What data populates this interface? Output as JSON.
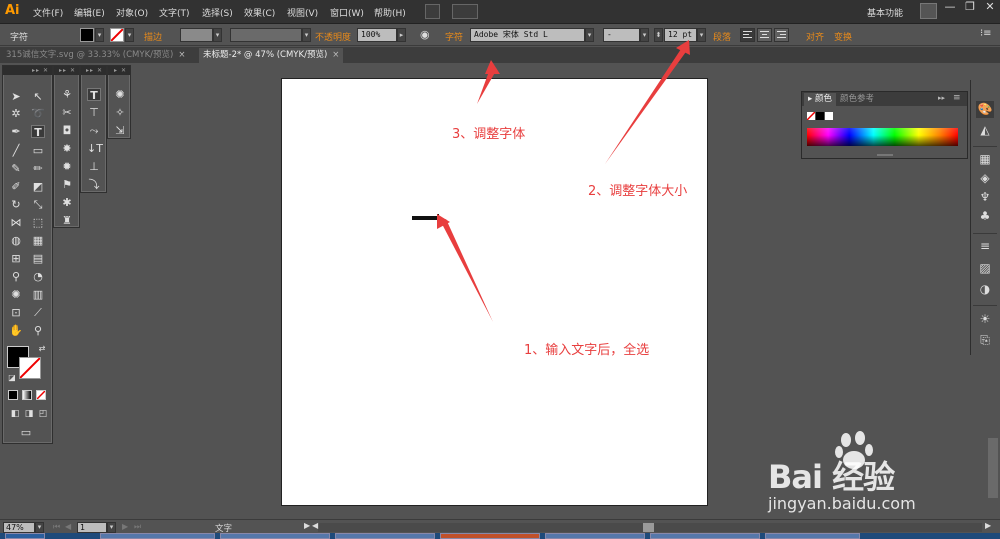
{
  "app": {
    "logo": "Ai",
    "menu": [
      "文件(F)",
      "编辑(E)",
      "对象(O)",
      "文字(T)",
      "选择(S)",
      "效果(C)",
      "视图(V)",
      "窗口(W)",
      "帮助(H)"
    ],
    "workspace": "基本功能",
    "window_buttons": [
      "—",
      "❐",
      "✕"
    ]
  },
  "control_bar": {
    "panel_name": "字符",
    "stroke_label": "描边",
    "opacity_label": "不透明度",
    "opacity_value": "100%",
    "char_label": "字符",
    "font_family": "Adobe 宋体 Std L",
    "font_style": "-",
    "font_size": "12 pt",
    "paragraph_label": "段落",
    "align_label": "对齐",
    "transform_label": "变换"
  },
  "tabs": [
    {
      "label": "315诚信文字.svg @ 33.33% (CMYK/预览)",
      "close": "×",
      "active": false
    },
    {
      "label": "未标题-2* @ 47% (CMYK/预览)",
      "close": "×",
      "active": true
    }
  ],
  "annotations": {
    "step1": "1、输入文字后，全选",
    "step2": "2、调整字体大小",
    "step3": "3、调整字体"
  },
  "color_panel": {
    "tabs": [
      "颜色",
      "颜色参考"
    ]
  },
  "status_bar": {
    "zoom": "47%",
    "page": "1",
    "tool_name": "文字"
  },
  "watermark": {
    "brand": "Bai 经验",
    "url": "jingyan.baidu.com"
  },
  "colors": {
    "annotation": "#e83e3e",
    "accent": "#e88a1a"
  }
}
